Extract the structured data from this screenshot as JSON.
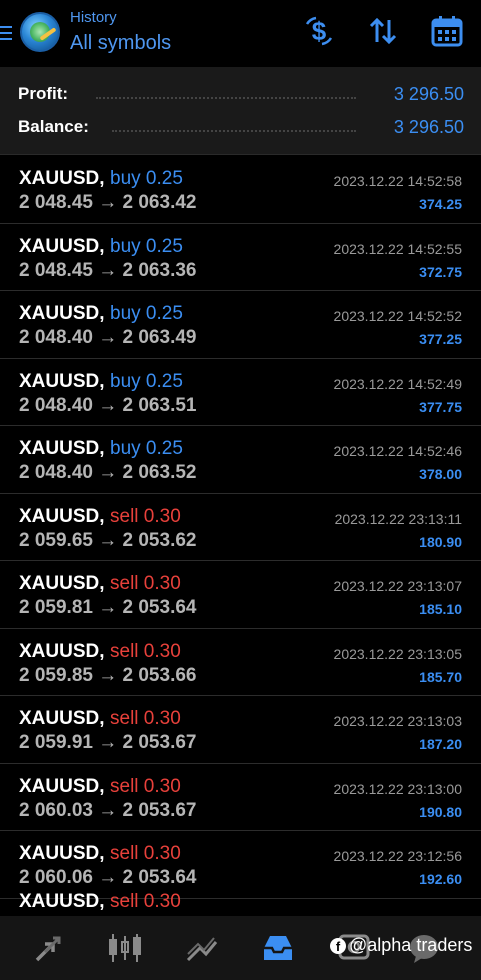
{
  "header": {
    "subtitle": "History",
    "title": "All symbols"
  },
  "summary": {
    "profit_label": "Profit:",
    "profit_value": "3 296.50",
    "balance_label": "Balance:",
    "balance_value": "3 296.50"
  },
  "deals": [
    {
      "symbol": "XAUUSD,",
      "type": "buy 0.25",
      "prices": "2 048.45 → 2 063.42",
      "time": "2023.12.22 14:52:58",
      "profit": "374.25"
    },
    {
      "symbol": "XAUUSD,",
      "type": "buy 0.25",
      "prices": "2 048.45 → 2 063.36",
      "time": "2023.12.22 14:52:55",
      "profit": "372.75"
    },
    {
      "symbol": "XAUUSD,",
      "type": "buy 0.25",
      "prices": "2 048.40 → 2 063.49",
      "time": "2023.12.22 14:52:52",
      "profit": "377.25"
    },
    {
      "symbol": "XAUUSD,",
      "type": "buy 0.25",
      "prices": "2 048.40 → 2 063.51",
      "time": "2023.12.22 14:52:49",
      "profit": "377.75"
    },
    {
      "symbol": "XAUUSD,",
      "type": "buy 0.25",
      "prices": "2 048.40 → 2 063.52",
      "time": "2023.12.22 14:52:46",
      "profit": "378.00"
    },
    {
      "symbol": "XAUUSD,",
      "type": "sell 0.30",
      "prices": "2 059.65 → 2 053.62",
      "time": "2023.12.22 23:13:11",
      "profit": "180.90"
    },
    {
      "symbol": "XAUUSD,",
      "type": "sell 0.30",
      "prices": "2 059.81 → 2 053.64",
      "time": "2023.12.22 23:13:07",
      "profit": "185.10"
    },
    {
      "symbol": "XAUUSD,",
      "type": "sell 0.30",
      "prices": "2 059.85 → 2 053.66",
      "time": "2023.12.22 23:13:05",
      "profit": "185.70"
    },
    {
      "symbol": "XAUUSD,",
      "type": "sell 0.30",
      "prices": "2 059.91 → 2 053.67",
      "time": "2023.12.22 23:13:03",
      "profit": "187.20"
    },
    {
      "symbol": "XAUUSD,",
      "type": "sell 0.30",
      "prices": "2 060.03 → 2 053.67",
      "time": "2023.12.22 23:13:00",
      "profit": "190.80"
    },
    {
      "symbol": "XAUUSD,",
      "type": "sell 0.30",
      "prices": "2 060.06 → 2 053.64",
      "time": "2023.12.22 23:12:56",
      "profit": "192.60"
    }
  ],
  "partial_deal": {
    "symbol": "XAUUSD,",
    "type": "sell 0.30"
  },
  "bottom_nav": {
    "items": [
      "quotes-icon",
      "chart-icon",
      "trade-icon",
      "history-icon",
      "messages-icon"
    ],
    "active": "history-icon"
  },
  "watermark": {
    "icon": "facebook-icon",
    "text": "@alpha traders"
  },
  "colors": {
    "accent": "#3b8ef2",
    "sell": "#e8413b",
    "background": "#000000",
    "panel": "#1a1a1a"
  }
}
